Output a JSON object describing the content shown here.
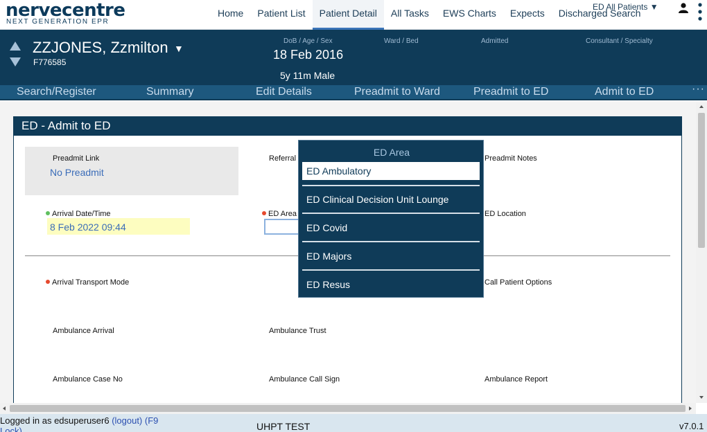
{
  "app": {
    "logo": "nervecentre",
    "logo_sub": "NEXT GENERATION EPR"
  },
  "nav": {
    "items": [
      "Home",
      "Patient List",
      "Patient Detail",
      "All Tasks",
      "EWS Charts",
      "Expects",
      "Discharged"
    ],
    "active": "Patient Detail",
    "all_patients": "ED All Patients ▼",
    "search": "Search"
  },
  "patient": {
    "name": "ZZJONES, Zzmilton",
    "number": "F776585",
    "dob_label": "DoB / Age / Sex",
    "dob": "18 Feb 2016",
    "age_sex": "5y 11m Male",
    "ward_label": "Ward / Bed",
    "admitted_label": "Admitted",
    "consultant_label": "Consultant / Specialty"
  },
  "actions": [
    "Search/Register",
    "Summary",
    "Edit Details",
    "Preadmit to Ward",
    "Preadmit to ED",
    "Admit to ED"
  ],
  "form": {
    "title": "ED - Admit to ED",
    "preadmit_link_label": "Preadmit Link",
    "preadmit_link_value": "No Preadmit",
    "referral_label": "Referral",
    "preadmit_notes_label": "Preadmit Notes",
    "arrival_label": "Arrival Date/Time",
    "arrival_value": "8 Feb 2022 09:44",
    "ed_area_label": "ED Area",
    "ed_location_label": "ED Location",
    "transport_label": "Arrival Transport Mode",
    "call_patient_label": "Call Patient Options",
    "ambulance_arrival_label": "Ambulance Arrival",
    "ambulance_trust_label": "Ambulance Trust",
    "ambulance_case_label": "Ambulance Case No",
    "ambulance_call_sign_label": "Ambulance Call Sign",
    "ambulance_report_label": "Ambulance Report"
  },
  "dropdown": {
    "title": "ED Area",
    "options": [
      "ED Ambulatory",
      "ED Clinical Decision Unit Lounge",
      "ED Covid",
      "ED Majors",
      "ED Resus"
    ],
    "selected": "ED Ambulatory"
  },
  "status": {
    "login": "Logged in as edsuperuser6",
    "logout": "(logout)",
    "lock": "(F9 Lock)",
    "env": "UHPT TEST",
    "version": "v7.0.1"
  },
  "colors": {
    "banner": "#0f3b58",
    "action_bar": "#1d587e",
    "accent": "#3a74b8"
  }
}
